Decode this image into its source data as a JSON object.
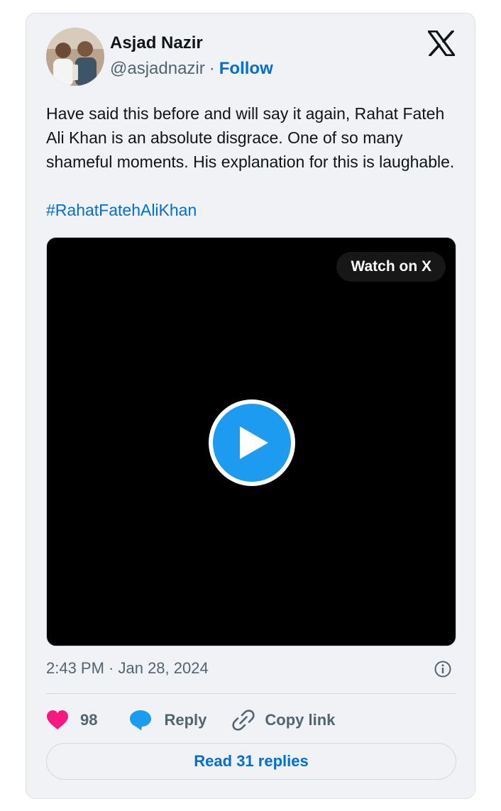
{
  "author": {
    "name": "Asjad Nazir",
    "handle": "@asjadnazir",
    "separator": "·",
    "follow_label": "Follow"
  },
  "tweet": {
    "text": "Have said this before and will say it again, Rahat Fateh Ali Khan is an absolute disgrace. One of so many shameful moments. His explanation for this is laughable.",
    "hashtag": "#RahatFatehAliKhan"
  },
  "video": {
    "watch_label": "Watch on X",
    "play_icon": "play-icon"
  },
  "meta": {
    "timestamp": "2:43 PM · Jan 28, 2024"
  },
  "actions": {
    "like_count": "98",
    "reply_label": "Reply",
    "copy_label": "Copy link"
  },
  "read_replies_label": "Read 31 replies",
  "colors": {
    "link": "#006fd6",
    "like": "#f91880",
    "reply_icon": "#1d9bf0",
    "play": "#1d9bf0",
    "card_bg": "#f0f2f5"
  }
}
